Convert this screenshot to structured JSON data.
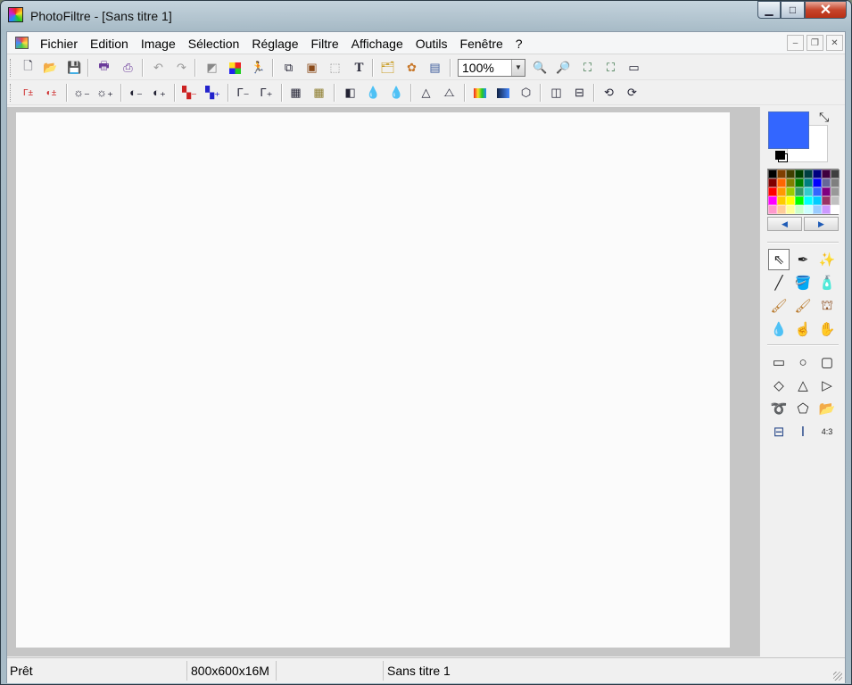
{
  "window": {
    "title": "PhotoFiltre - [Sans titre 1]",
    "app_icon": "photofiltre-icon"
  },
  "menubar": {
    "items": [
      "Fichier",
      "Edition",
      "Image",
      "Sélection",
      "Réglage",
      "Filtre",
      "Affichage",
      "Outils",
      "Fenêtre",
      "?"
    ]
  },
  "toolbar1": {
    "zoom_value": "100%"
  },
  "colors": {
    "foreground": "#3366ff",
    "background": "#ffffff"
  },
  "palette": [
    "#000000",
    "#7f3f00",
    "#3f3f00",
    "#003f00",
    "#003f3f",
    "#00007f",
    "#3f003f",
    "#3f3f3f",
    "#7f0000",
    "#ff6600",
    "#7f7f00",
    "#007f00",
    "#007f7f",
    "#0000ff",
    "#666699",
    "#7f7f7f",
    "#ff0000",
    "#ff9900",
    "#99cc00",
    "#339966",
    "#33cccc",
    "#3366ff",
    "#800080",
    "#999999",
    "#ff00ff",
    "#ffcc00",
    "#ffff00",
    "#00ff00",
    "#00ffff",
    "#00ccff",
    "#993366",
    "#c0c0c0",
    "#ff99cc",
    "#ffcc99",
    "#ffff99",
    "#ccffcc",
    "#ccffff",
    "#99ccff",
    "#cc99ff",
    "#ffffff"
  ],
  "statusbar": {
    "state": "Prêt",
    "image_info": "800x600x16M",
    "empty": "",
    "document": "Sans titre 1"
  }
}
